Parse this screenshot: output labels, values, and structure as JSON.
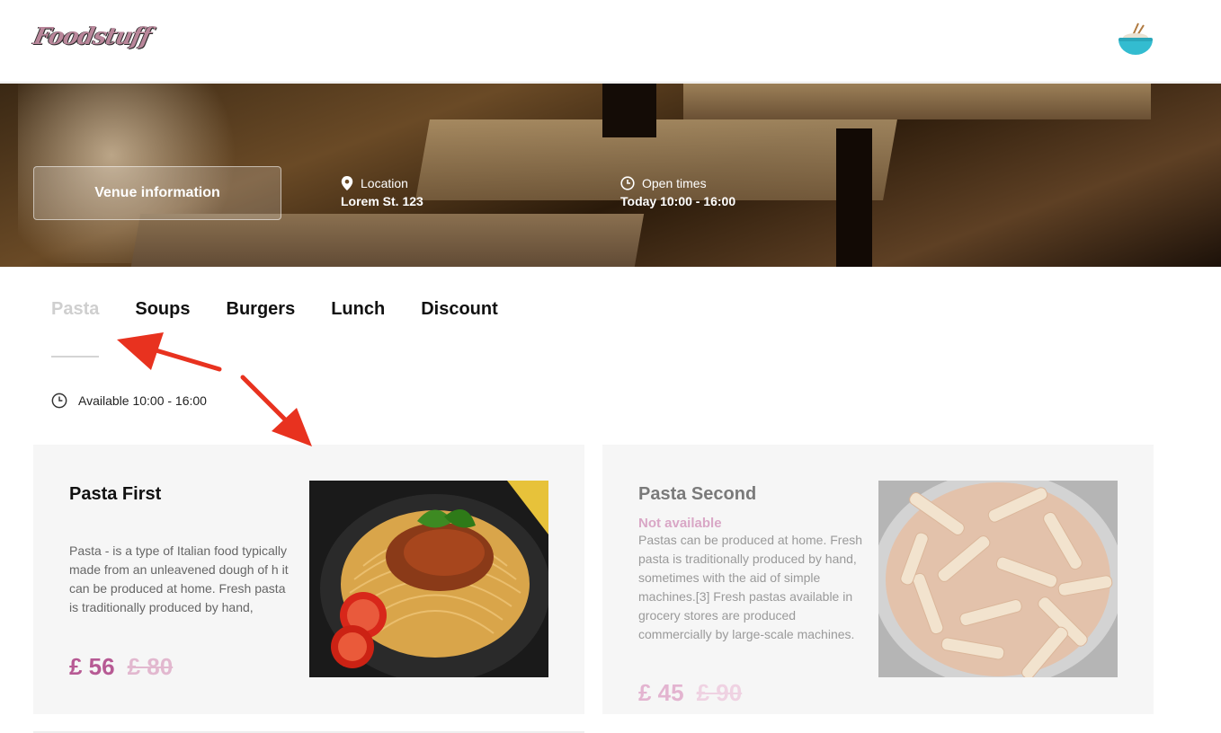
{
  "header": {
    "logo_text": "Foodstuff",
    "bowl_icon": "noodle-bowl-icon"
  },
  "hero": {
    "venue_button": "Venue information",
    "location_label": "Location",
    "location_value": "Lorem St. 123",
    "times_label": "Open times",
    "times_value": "Today 10:00 - 16:00"
  },
  "tabs": [
    {
      "label": "Pasta",
      "active": true
    },
    {
      "label": "Soups"
    },
    {
      "label": "Burgers"
    },
    {
      "label": "Lunch"
    },
    {
      "label": "Discount"
    }
  ],
  "availability": "Available 10:00 - 16:00",
  "items": [
    {
      "name": "Pasta First",
      "status": "",
      "description": "Pasta - is a type of Italian food typically made from an unleavened dough of h it can be produced at home. Fresh pasta is traditionally produced by hand,",
      "price": "£ 56",
      "old_price": "£ 80"
    },
    {
      "name": "Pasta Second",
      "status": "Not available",
      "description": "Pastas can be produced at home. Fresh pasta is traditionally produced by hand, sometimes with the aid of simple machines.[3] Fresh pastas available in grocery stores are produced commercially by large-scale machines.",
      "price": "£ 45",
      "old_price": "£ 90"
    }
  ],
  "colors": {
    "accent": "#b75a94",
    "annotation": "#e8321f"
  }
}
